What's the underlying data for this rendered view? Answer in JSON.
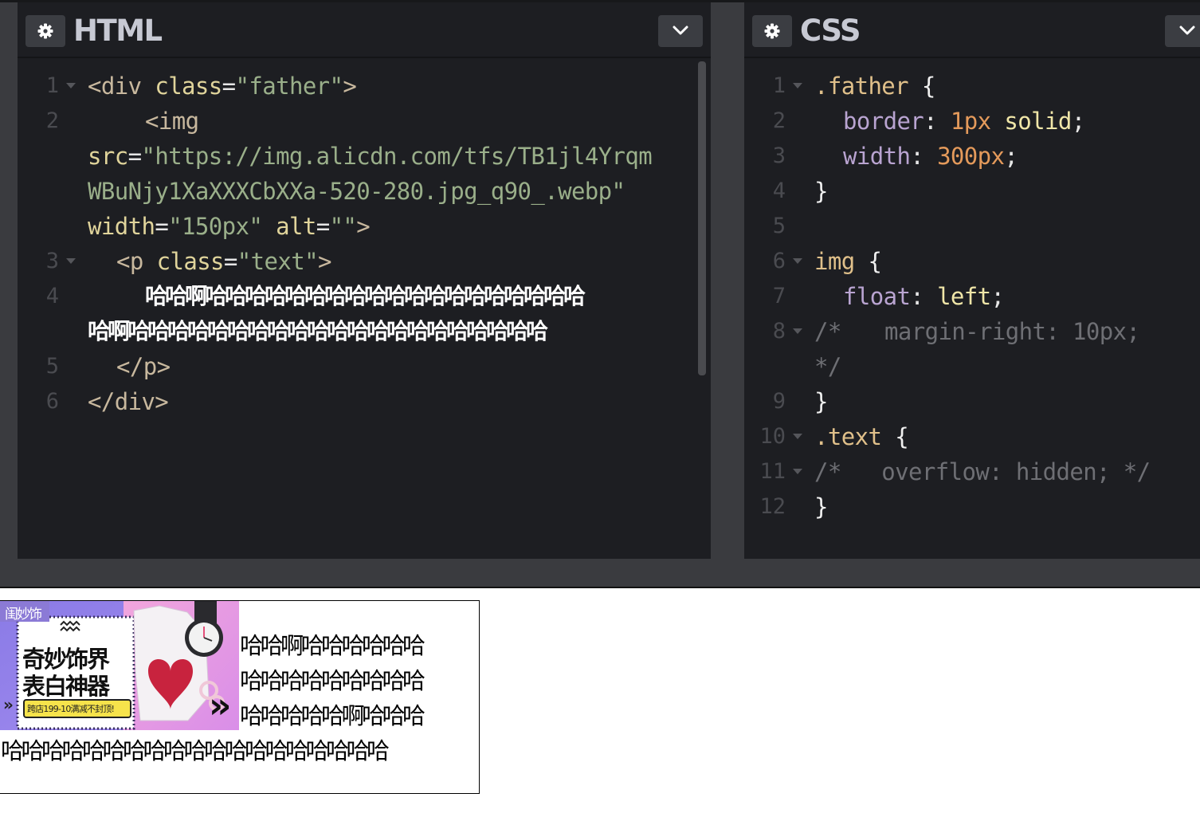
{
  "panes": {
    "html": {
      "title": "HTML"
    },
    "css": {
      "title": "CSS"
    }
  },
  "html_code": {
    "line_numbers": [
      "1",
      "2",
      "3",
      "4",
      "5",
      "6"
    ],
    "line1": {
      "open": "<div",
      "attr": "class",
      "eq": "=",
      "value": "\"father\"",
      "close": ">"
    },
    "line2": {
      "tag": "<img",
      "src_attr": "src",
      "eq": "=",
      "src_part1": "\"https://img.alicdn.com/tfs/TB1jl4Yrqm",
      "src_part2": "WBuNjy1XaXXXCbXXa-520-280.jpg_q90_.webp\"",
      "width_attr": "width",
      "width_value": "\"150px\"",
      "alt_attr": "alt",
      "alt_value": "\"\"",
      "close": ">"
    },
    "line3": {
      "open": "<p",
      "attr": "class",
      "eq": "=",
      "value": "\"text\"",
      "close": ">"
    },
    "line4": {
      "text_part1": "哈哈啊哈哈哈哈哈哈哈哈哈哈哈哈哈哈哈哈哈哈哈",
      "text_part2": "哈啊哈哈哈哈哈哈哈哈哈哈哈哈哈哈哈哈哈哈哈哈哈"
    },
    "line5": "</p>",
    "line6": "</div>"
  },
  "css_code": {
    "line_numbers": [
      "1",
      "2",
      "3",
      "4",
      "5",
      "6",
      "7",
      "8",
      "9",
      "10",
      "11",
      "12"
    ],
    "l1_selector": ".father",
    "open_brace": "{",
    "close_brace": "}",
    "l2_prop": "border",
    "l2_num": "1px",
    "l2_val": "solid",
    "l3_prop": "width",
    "l3_num": "300px",
    "l6_selector": "img",
    "l7_prop": "float",
    "l7_val": "left",
    "l8_comment_open": "/*",
    "l8_comment_body": "margin-right: 10px;",
    "l8_comment_close": "*/",
    "l10_selector": ".text",
    "l11_comment": "/*   overflow: hidden; */",
    "colon": ":",
    "semicolon": ";"
  },
  "preview": {
    "banner": {
      "brand": "闺妙饰",
      "headline_1": "奇妙饰界",
      "headline_2": "表白神器",
      "promo": "跨店199-10满减不封顶!",
      "chevrons": "»"
    },
    "paragraph_lines": [
      "哈哈啊哈哈哈哈哈哈",
      "哈哈哈哈哈哈哈哈哈",
      "哈哈哈哈哈啊哈哈哈",
      "哈哈哈哈哈哈哈哈哈哈哈哈哈哈哈哈哈哈哈"
    ]
  },
  "colors": {
    "editor_bg": "#1d1e22",
    "chrome_bg": "#3a3b3f",
    "tag": "#c8b89e",
    "attribute": "#e0d49b",
    "string": "#9aaf8a",
    "property": "#b9a4d1",
    "number": "#e49a5b",
    "comment": "#6e6f74"
  }
}
